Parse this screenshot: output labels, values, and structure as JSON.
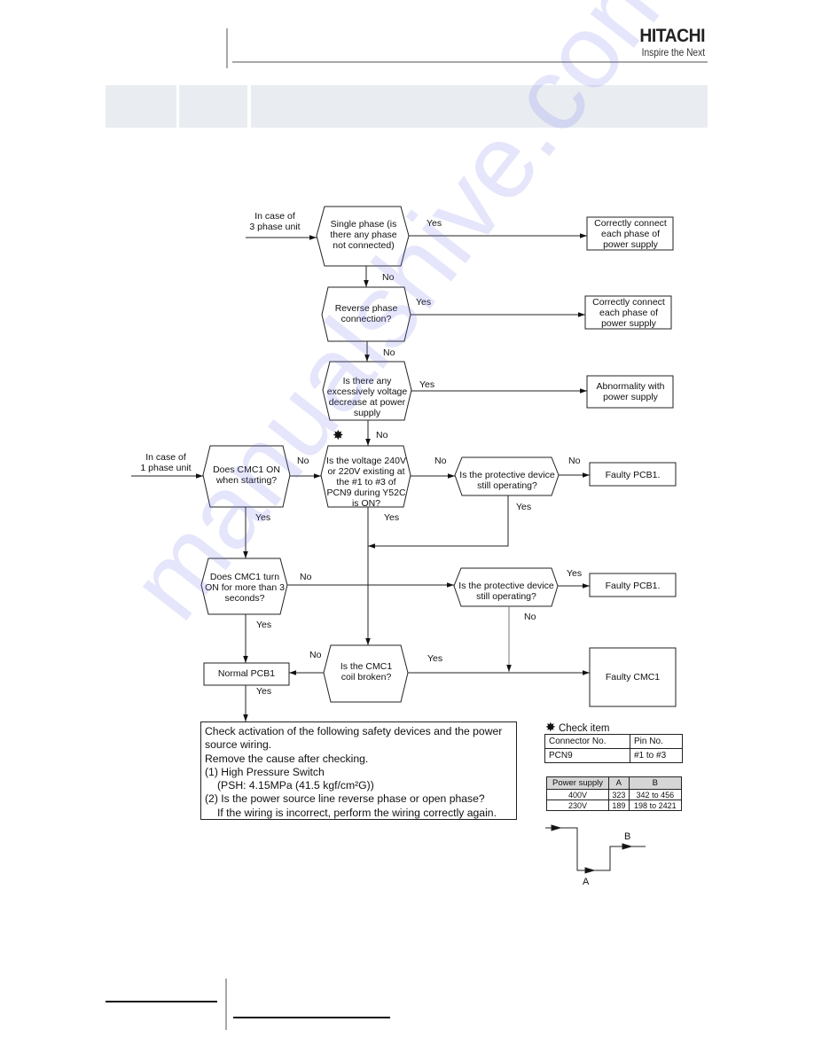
{
  "header": {
    "brand_name": "HITACHI",
    "brand_tagline": "Inspire the Next",
    "section_cells": [
      "",
      "",
      ""
    ]
  },
  "flowchart": {
    "start_3phase": "In case of\n3 phase unit",
    "start_1phase": "In case of\n1 phase unit",
    "decisions": {
      "single_phase": "Single phase (is there any phase not connected)",
      "reverse_phase": "Reverse phase connection?",
      "voltage_decrease": "Is there any excessively voltage decrease at power supply",
      "cmc1_on_starting": "Does CMC1 ON when starting?",
      "voltage_pcn9": "Is the voltage 240V or 220V existing at the #1 to #3 of PCN9 during Y52C is ON?",
      "protective_device_1": "Is the protective device still operating?",
      "cmc1_on_3sec": "Does CMC1 turn ON for more than 3 seconds?",
      "protective_device_2": "Is the protective device still operating?",
      "cmc1_coil_broken": "Is the CMC1 coil broken?"
    },
    "results": {
      "connect_phase_1": "Correctly connect each phase of power supply",
      "connect_phase_2": "Correctly connect each phase of power supply",
      "abnormality_power": "Abnormality with power supply",
      "faulty_pcb1_1": "Faulty PCB1.",
      "faulty_pcb1_2": "Faulty PCB1.",
      "faulty_cmc1": "Faulty CMC1",
      "normal_pcb1": "Normal PCB1"
    },
    "edge_labels": {
      "yes": "Yes",
      "no": "No"
    },
    "check_star_icon": "asterisk-star-icon"
  },
  "action_note": {
    "lines": [
      "Check activation of the following safety devices and the power",
      "source wiring.",
      "Remove the cause after checking.",
      "(1) High Pressure Switch",
      "(PSH: 4.15MPa (41.5 kgf/cm²G))",
      "(2) Is the power source line reverse phase or open phase?",
      "If the wiring is incorrect, perform the wiring correctly again."
    ]
  },
  "check_item": {
    "title": "Check item",
    "table": {
      "headers": [
        "Connector No.",
        "Pin No."
      ],
      "rows": [
        [
          "PCN9",
          "#1 to #3"
        ]
      ]
    }
  },
  "power_table": {
    "headers": [
      "Power supply",
      "A",
      "B"
    ],
    "rows": [
      [
        "400V",
        "323",
        "342 to 456"
      ],
      [
        "230V",
        "189",
        "198 to 2421"
      ]
    ]
  },
  "waveform": {
    "label_a": "A",
    "label_b": "B"
  },
  "watermark": "manualshive.com"
}
